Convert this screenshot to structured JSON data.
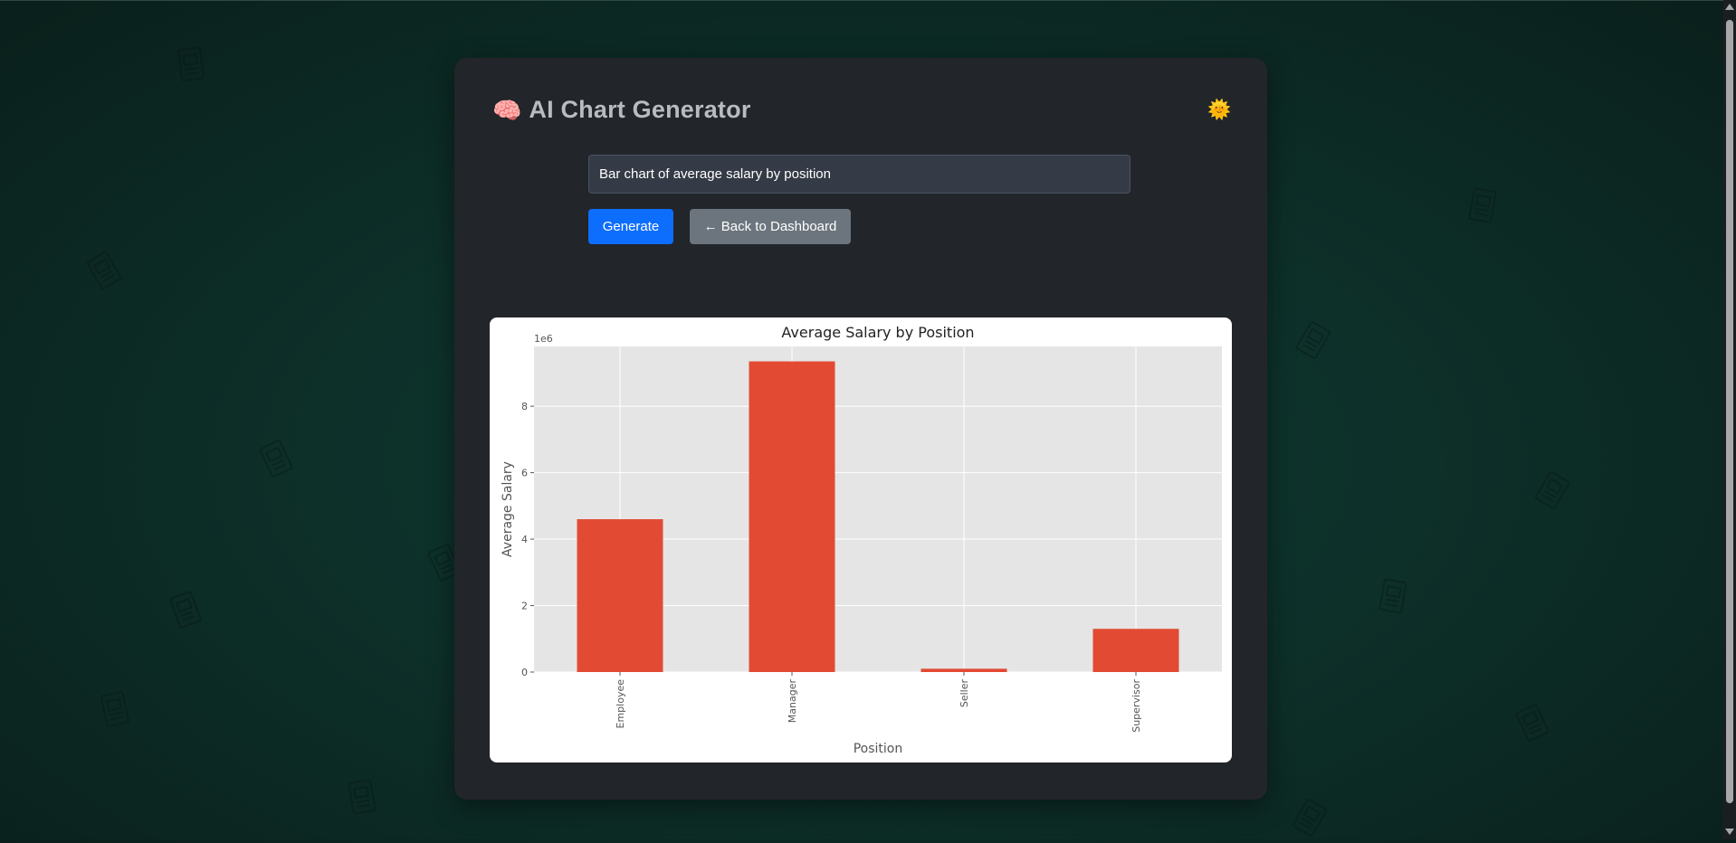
{
  "app": {
    "title": "AI Chart Generator",
    "brain_icon": "🧠",
    "theme_toggle_icon": "🌞"
  },
  "prompt": {
    "value": "Bar chart of average salary by position"
  },
  "buttons": {
    "generate_label": "Generate",
    "back_label": "← Back to Dashboard"
  },
  "colors": {
    "bar": "#e24a33",
    "plot_background": "#e5e5e5",
    "generate_button": "#0d6efd",
    "back_button": "#6c757d"
  },
  "chart_data": {
    "type": "bar",
    "title": "Average Salary by Position",
    "xlabel": "Position",
    "ylabel": "Average Salary",
    "offset_label": "1e6",
    "categories": [
      "Employee",
      "Manager",
      "Seller",
      "Supervisor"
    ],
    "values": [
      4.6,
      9.35,
      0.1,
      1.3
    ],
    "value_multiplier": 1000000,
    "ylim": [
      0,
      9.8
    ],
    "yticks": [
      0,
      2,
      4,
      6,
      8
    ],
    "grid": true
  }
}
